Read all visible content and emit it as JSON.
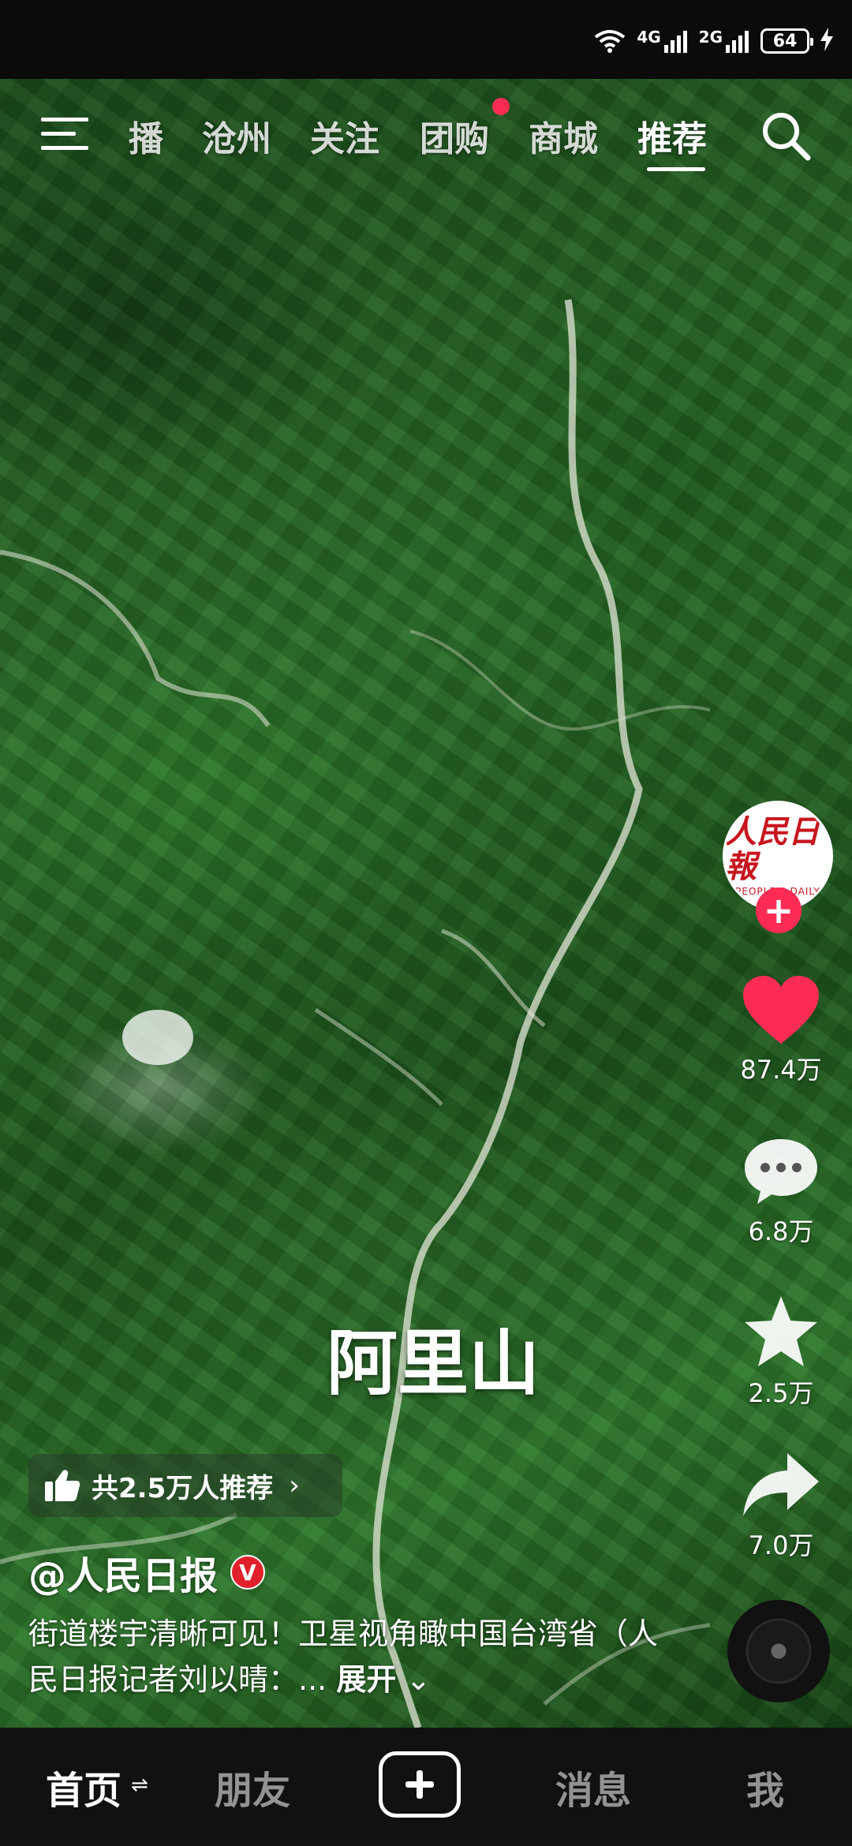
{
  "status_bar": {
    "signal_1_label": "4G",
    "signal_2_label": "2G",
    "battery": "64",
    "icons": [
      "wifi-icon",
      "signal-icon",
      "battery-icon",
      "charging-icon"
    ]
  },
  "top_tabs": {
    "items": [
      "播",
      "沧州",
      "关注",
      "团购",
      "商城",
      "推荐"
    ],
    "active": "推荐",
    "badge_on": "团购"
  },
  "video": {
    "caption": "阿里山",
    "recommend_text": "共2.5万人推荐",
    "author": "@人民日报",
    "verified_mark": "V",
    "description": "街道楼宇清晰可见！卫星视角瞰中国台湾省（人民日报记者刘以晴：...",
    "expand_label": "展开"
  },
  "avatar": {
    "logo_cn": "人民日報",
    "logo_en": "PEOPLE'S DAILY",
    "follow_symbol": "+"
  },
  "rail": {
    "likes": "87.4万",
    "comments": "6.8万",
    "favorites": "2.5万",
    "shares": "7.0万"
  },
  "bottom_nav": {
    "home": "首页",
    "home_swap": "⇌",
    "friends": "朋友",
    "messages": "消息",
    "me": "我"
  },
  "colors": {
    "accent": "#fe2c55",
    "verified": "#e0202a",
    "logo_red": "#c7161e"
  }
}
